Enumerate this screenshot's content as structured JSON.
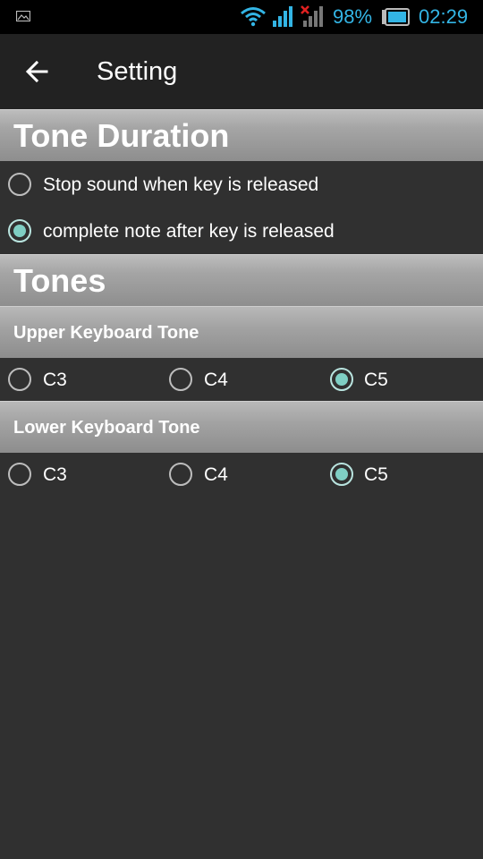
{
  "status_bar": {
    "battery_percent": "98%",
    "time": "02:29",
    "accent_color": "#33b5e5",
    "icons": [
      "gallery-notification-icon",
      "wifi-icon",
      "signal-icon",
      "signal-no-sim-icon",
      "battery-icon"
    ]
  },
  "action_bar": {
    "title": "Setting",
    "back_icon": "arrow-left-icon"
  },
  "tone_duration": {
    "header": "Tone Duration",
    "options": [
      {
        "label": "Stop sound when key is released",
        "checked": false
      },
      {
        "label": "complete note after key is released",
        "checked": true
      }
    ]
  },
  "tones": {
    "header": "Tones",
    "upper": {
      "header": "Upper Keyboard Tone",
      "options": [
        {
          "label": "C3",
          "checked": false
        },
        {
          "label": "C4",
          "checked": false
        },
        {
          "label": "C5",
          "checked": true
        }
      ]
    },
    "lower": {
      "header": "Lower Keyboard Tone",
      "options": [
        {
          "label": "C3",
          "checked": false
        },
        {
          "label": "C4",
          "checked": false
        },
        {
          "label": "C5",
          "checked": true
        }
      ]
    }
  },
  "colors": {
    "background": "#303030",
    "action_bar": "#222222",
    "radio_checked": "#7fcfc4"
  }
}
